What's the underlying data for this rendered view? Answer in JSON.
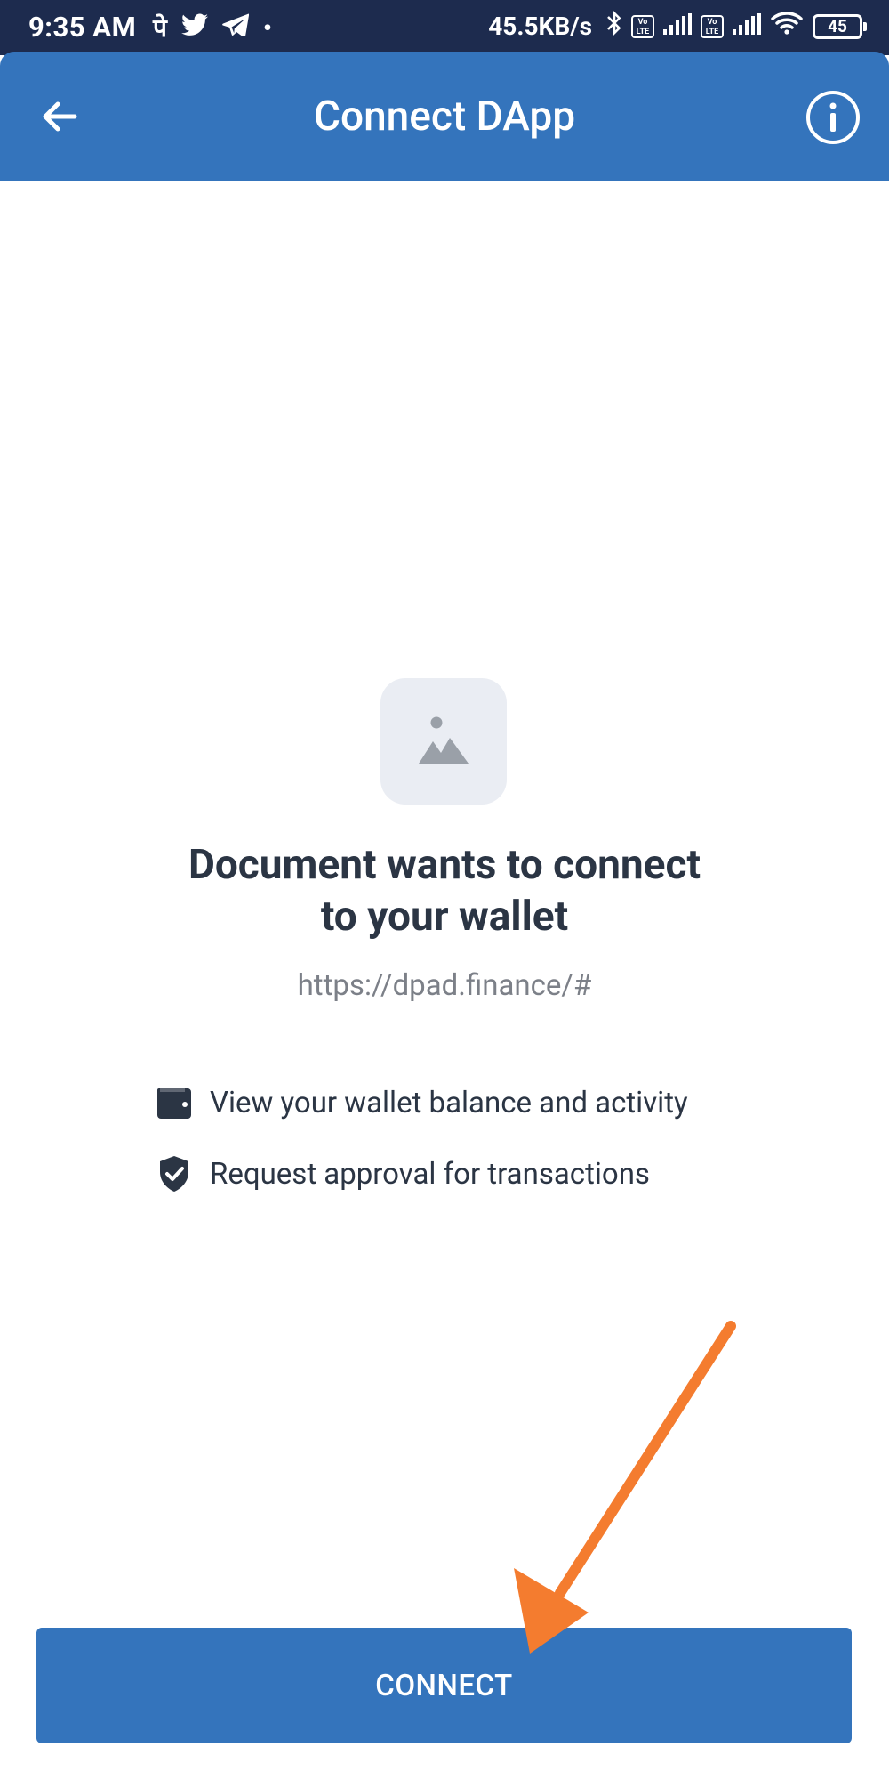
{
  "status_bar": {
    "time": "9:35 AM",
    "left_icons": [
      "पे",
      "twitter-icon",
      "telegram-icon",
      "•"
    ],
    "network_speed": "45.5KB/s",
    "battery": "45"
  },
  "header": {
    "title": "Connect DApp",
    "background_color": "#3474bc"
  },
  "dapp": {
    "image_icon": "image-placeholder-icon",
    "heading_line1": "Document wants to connect",
    "heading_line2": "to your wallet",
    "url": "https://dpad.finance/#"
  },
  "permissions": [
    {
      "icon": "wallet-icon",
      "label": "View your wallet balance and activity"
    },
    {
      "icon": "shield-check-icon",
      "label": "Request approval for transactions"
    }
  ],
  "connect_button": {
    "label": "CONNECT",
    "color": "#3474bc"
  },
  "annotation": {
    "arrow_color": "#f47c2f"
  }
}
